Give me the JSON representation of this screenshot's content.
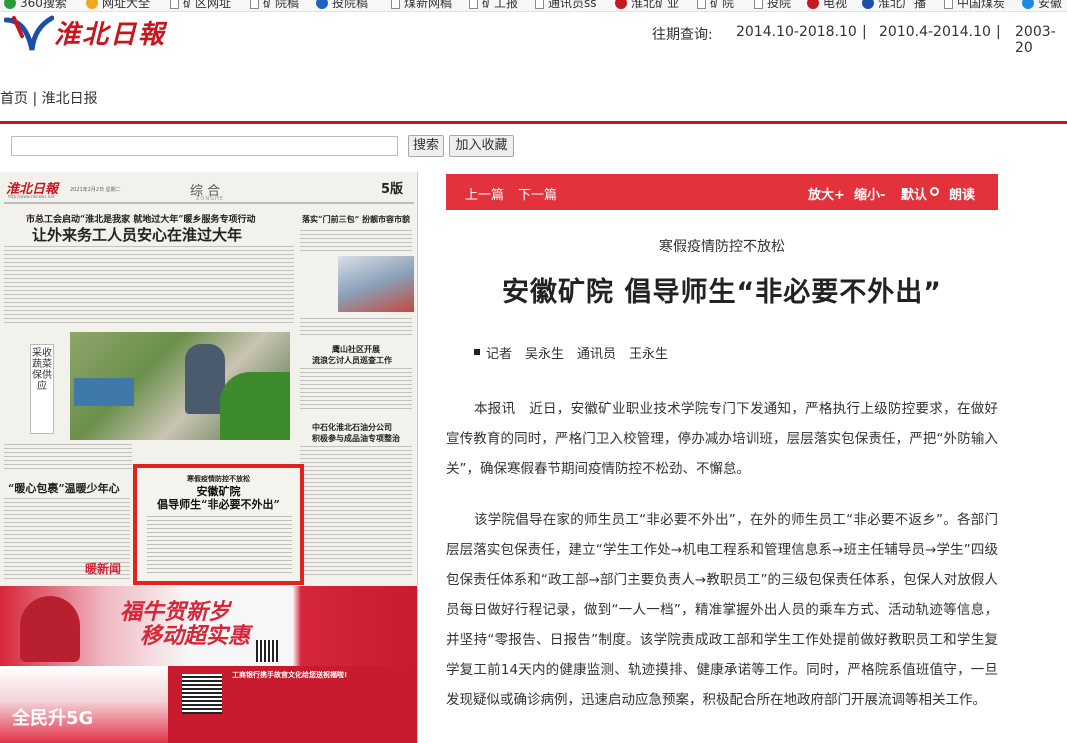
{
  "browser": {
    "bookmarks": [
      {
        "label": "360搜索",
        "icon": "360-icon",
        "color": "#2a9d3a"
      },
      {
        "label": "网址大全",
        "icon": "plus-circle-icon",
        "color": "#f0a91c"
      },
      {
        "label": "矿区网址",
        "icon": "document-icon"
      },
      {
        "label": "矿院稿",
        "icon": "document-icon"
      },
      {
        "label": "投院稿",
        "icon": "globe-icon",
        "color": "#1e62c4"
      },
      {
        "label": "煤新网稿",
        "icon": "document-icon"
      },
      {
        "label": "矿工报",
        "icon": "document-icon"
      },
      {
        "label": "通讯员ss",
        "icon": "document-icon"
      },
      {
        "label": "淮北矿业",
        "icon": "logo-icon",
        "color": "#c8161d"
      },
      {
        "label": "矿院",
        "icon": "document-icon"
      },
      {
        "label": "投院",
        "icon": "document-icon"
      },
      {
        "label": "电视",
        "icon": "c-logo-icon",
        "color": "#c8161d"
      },
      {
        "label": "淮北广播",
        "icon": "h-logo-icon",
        "color": "#1e4fa8"
      },
      {
        "label": "中国煤炭",
        "icon": "document-icon"
      },
      {
        "label": "安徽",
        "icon": "e-logo-icon",
        "color": "#1e88e5"
      }
    ]
  },
  "header": {
    "logo_text": "淮北日報",
    "period_label": "往期查询:",
    "periods": [
      "2014.10-2018.10",
      "2010.4-2014.10",
      "2003-20"
    ],
    "separator": "|"
  },
  "breadcrumb": "首页 | 淮北日报",
  "search": {
    "value": "",
    "search_label": "搜索",
    "favorite_label": "加入收藏"
  },
  "newspaper": {
    "logo": "淮北日報",
    "date": "2021年2月2日 星期二",
    "website": "http://www.hbnews.net",
    "section": "综 合",
    "section_pinyin": "ZONGHE",
    "edition": "5版",
    "headline_kicker": "市总工会启动“淮北是我家 就地过大年”暖乡服务专项行动",
    "headline_main": "让外来务工人员安心在淮过大年",
    "side_headline": "落实“门前三包” 扮靓市容市貌",
    "photo_caption": "采收蔬菜保供应",
    "headline_2a": "鹰山社区开展",
    "headline_2b": "流浪乞讨人员巡查工作",
    "headline_3a": "中石化淮北石油分公司",
    "headline_3b": "积极参与成品油专项整治",
    "warm_title": "“暖心包裹”温暖少年心",
    "red_banner": "暖新闻",
    "highlight_kicker": "寒假疫情防控不放松",
    "highlight_title_1": "安徽矿院",
    "highlight_title_2": "倡导师生“非必要不外出”",
    "ad1_text_1": "福牛贺新岁",
    "ad1_text_2": "移动超实惠",
    "ad2_text": "全民升5G",
    "ad2_bank": "工商银行携手故宫文化给您送祝福啦!"
  },
  "article": {
    "toolbar": {
      "prev": "上一篇",
      "next": "下一篇",
      "zoom_in": "放大+",
      "zoom_out": "缩小-",
      "default": "默认",
      "read": "朗读",
      "color": "#e3323b"
    },
    "kicker": "寒假疫情防控不放松",
    "headline": "安徽矿院 倡导师生“非必要不外出”",
    "byline": "记者　吴永生　通讯员　王永生",
    "paragraphs": [
      "本报讯　近日，安徽矿业职业技术学院专门下发通知，严格执行上级防控要求，在做好宣传教育的同时，严格门卫入校管理，停办减办培训班，层层落实包保责任，严把“外防输入关”，确保寒假春节期间疫情防控不松劲、不懈怠。",
      "该学院倡导在家的师生员工“非必要不外出”，在外的师生员工“非必要不返乡”。各部门层层落实包保责任，建立“学生工作处→机电工程系和管理信息系→班主任辅导员→学生”四级包保责任体系和“政工部→部门主要负责人→教职员工”的三级包保责任体系，包保人对放假人员每日做好行程记录，做到“一人一档”，精准掌握外出人员的乘车方式、活动轨迹等信息，并坚持“零报告、日报告”制度。该学院责成政工部和学生工作处提前做好教职员工和学生复学复工前14天内的健康监测、轨迹摸排、健康承诺等工作。同时，严格院系值班值守，一旦发现疑似或确诊病例，迅速启动应急预案，积极配合所在地政府部门开展流调等相关工作。"
    ]
  }
}
